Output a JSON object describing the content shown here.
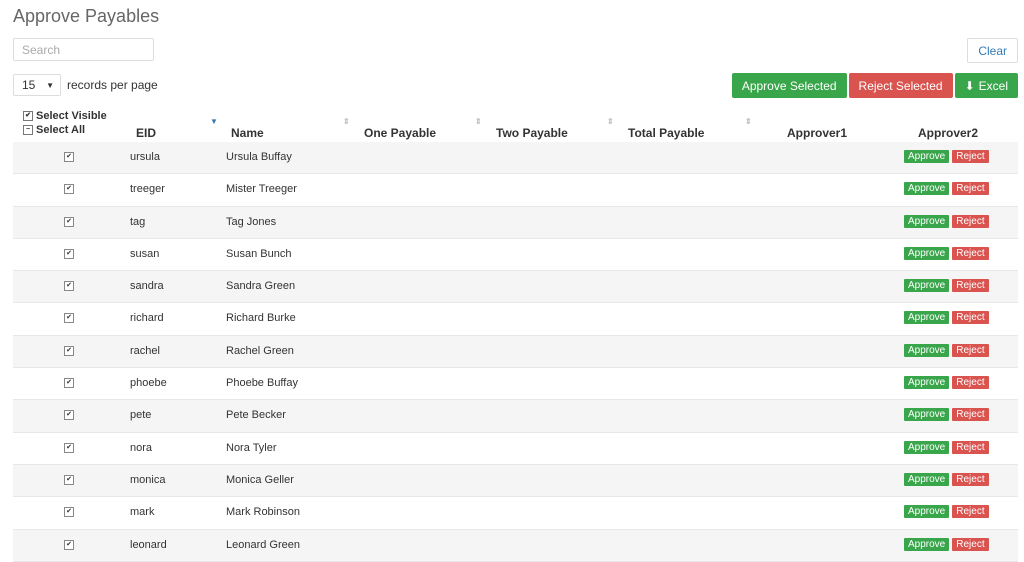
{
  "page": {
    "title": "Approve Payables"
  },
  "search": {
    "placeholder": "Search",
    "value": ""
  },
  "clear_label": "Clear",
  "records": {
    "value": "15",
    "suffix": "records per page"
  },
  "toolbar": {
    "approve_selected": "Approve Selected",
    "reject_selected": "Reject Selected",
    "excel": "Excel"
  },
  "colors": {
    "green": "#3aa64b",
    "red": "#d9534f"
  },
  "table": {
    "select_visible": "Select Visible",
    "select_all": "Select All",
    "headers": {
      "eid": "EID",
      "name": "Name",
      "one_payable": "One Payable",
      "two_payable": "Two Payable",
      "total_payable": "Total Payable",
      "approver1": "Approver1",
      "approver2": "Approver2"
    },
    "row_buttons": {
      "approve": "Approve",
      "reject": "Reject"
    },
    "rows": [
      {
        "eid": "ursula",
        "name": "Ursula Buffay",
        "checked": true
      },
      {
        "eid": "treeger",
        "name": "Mister Treeger",
        "checked": true
      },
      {
        "eid": "tag",
        "name": "Tag Jones",
        "checked": true
      },
      {
        "eid": "susan",
        "name": "Susan Bunch",
        "checked": true
      },
      {
        "eid": "sandra",
        "name": "Sandra Green",
        "checked": true
      },
      {
        "eid": "richard",
        "name": "Richard Burke",
        "checked": true
      },
      {
        "eid": "rachel",
        "name": "Rachel Green",
        "checked": true
      },
      {
        "eid": "phoebe",
        "name": "Phoebe Buffay",
        "checked": true
      },
      {
        "eid": "pete",
        "name": "Pete Becker",
        "checked": true
      },
      {
        "eid": "nora",
        "name": "Nora Tyler",
        "checked": true
      },
      {
        "eid": "monica",
        "name": "Monica Geller",
        "checked": true
      },
      {
        "eid": "mark",
        "name": "Mark Robinson",
        "checked": true
      },
      {
        "eid": "leonard",
        "name": "Leonard Green",
        "checked": true
      }
    ]
  }
}
